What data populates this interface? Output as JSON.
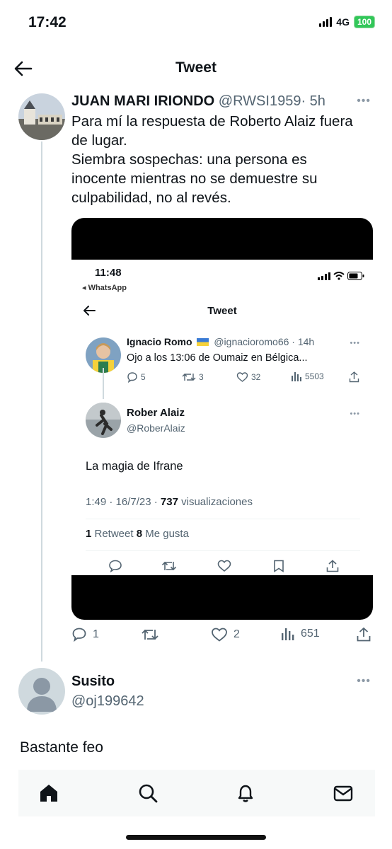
{
  "status_bar": {
    "time": "17:42",
    "network": "4G",
    "battery": "100"
  },
  "nav": {
    "title": "Tweet",
    "back_icon": "arrow-left-icon"
  },
  "tweet": {
    "author_name": "JUAN MARI IRIONDO",
    "author_handle": "@RWSI1959",
    "time": "· 5h",
    "more": "•••",
    "text_lines": [
      "Para mí la respuesta de Roberto Alaiz fuera",
      "de lugar.",
      "Siembra sospechas: una persona es",
      "inocente mientras no se demuestre su",
      "culpabilidad, no al revés."
    ],
    "actions": {
      "replies": "1",
      "retweets": "",
      "likes": "2",
      "views": "651"
    }
  },
  "screenshot": {
    "time": "11:48",
    "back_app": "◂ WhatsApp",
    "title": "Tweet",
    "quoted": {
      "name": "Ignacio Romo",
      "flag": "ukraine-flag",
      "handle_time": "@ignacioromo66 · 14h",
      "text": "Ojo a los 13:06 de Oumaiz en Bélgica...",
      "replies": "5",
      "retweets": "3",
      "likes": "32",
      "views": "5503"
    },
    "reply": {
      "name": "Rober Alaiz",
      "handle": "@RoberAlaiz",
      "text": "La magia de Ifrane",
      "meta_date": "1:49 · 16/7/23 · ",
      "meta_views_count": "737",
      "meta_views_label": " visualizaciones",
      "retweets_count": "1",
      "retweets_label": " Retweet ",
      "likes_count": "8",
      "likes_label": " Me gusta"
    }
  },
  "reply": {
    "name": "Susito",
    "handle": "@oj199642",
    "more": "•••",
    "text": "Bastante feo"
  },
  "tab_bar": {
    "items": [
      "home-icon",
      "search-icon",
      "notifications-icon",
      "messages-icon"
    ]
  },
  "colors": {
    "text": "#0f1419",
    "secondary": "#536471",
    "divider": "#cfd9de",
    "battery": "#32c759"
  }
}
